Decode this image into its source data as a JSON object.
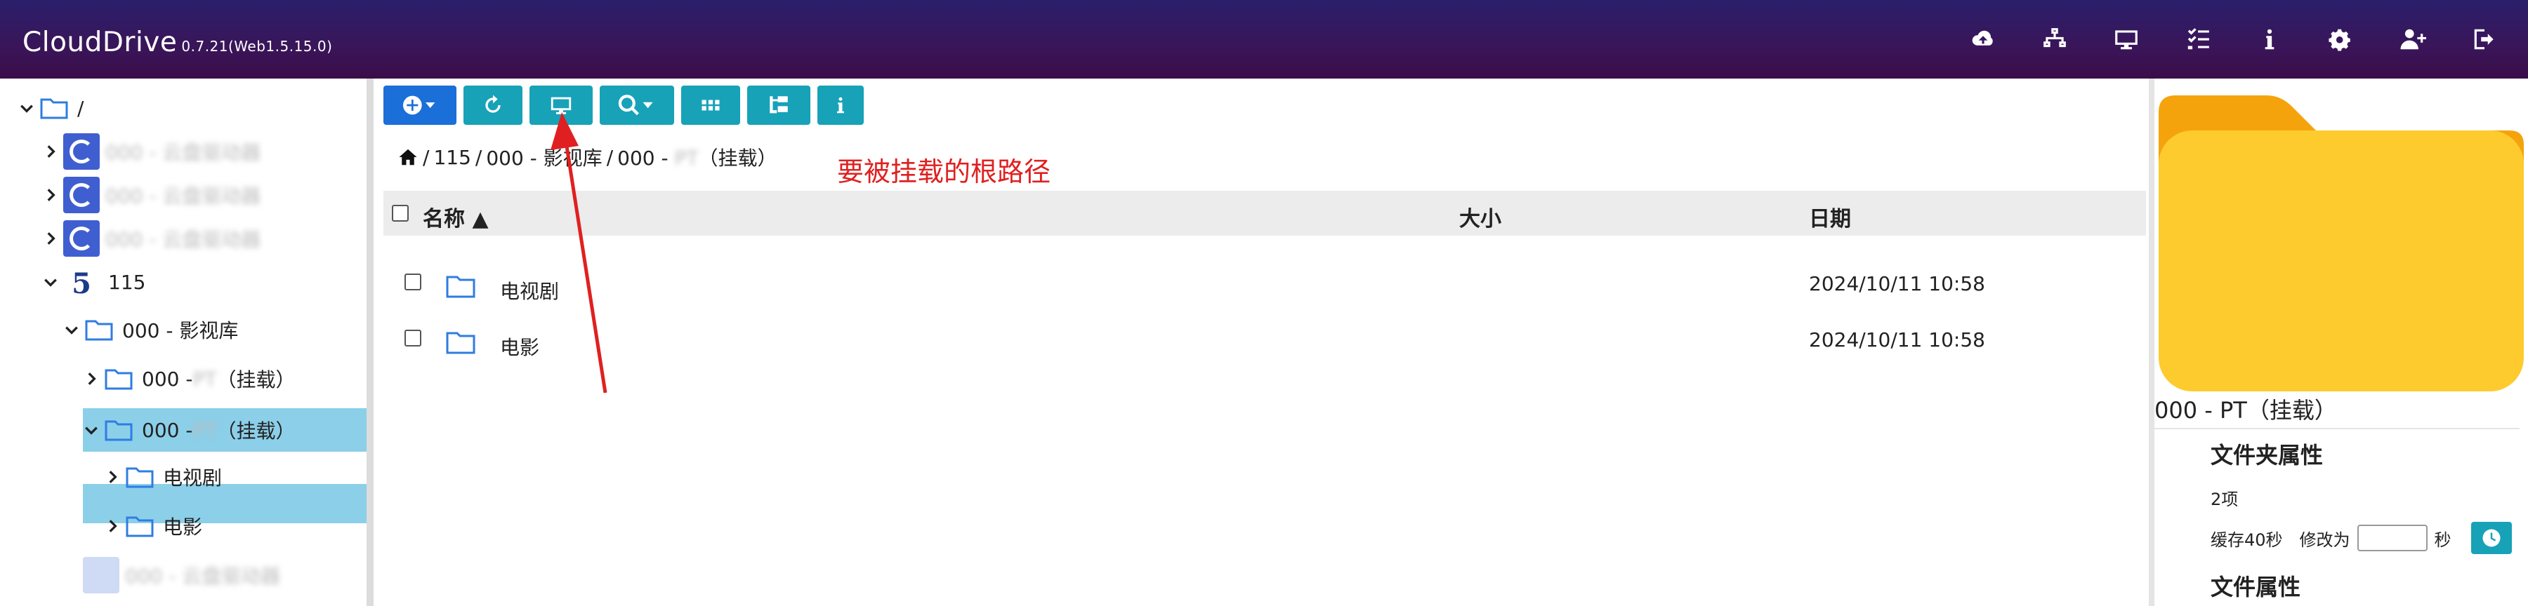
{
  "header": {
    "brand": "CloudDrive",
    "version": "0.7.21(Web1.5.15.0)",
    "icons": [
      "cloud-upload-icon",
      "network-icon",
      "monitor-icon",
      "tasks-icon",
      "info-icon",
      "settings-icon",
      "add-user-icon",
      "logout-icon"
    ],
    "bg_color": "#3a1559"
  },
  "tree": {
    "root": "/",
    "drive_placeholder": "000 - 云盘驱动器",
    "drive115": "115",
    "library": "000 - 影视库",
    "mount1_prefix": "000 - ",
    "mount1_blur": "PT",
    "mount1_suffix": "（挂载）",
    "mount2_prefix": "000 - ",
    "mount2_blur": "PT",
    "mount2_suffix": "（挂载）",
    "child1": "电视剧",
    "child2": "电影",
    "selected_color": "#8ccfe9"
  },
  "breadcrumb": {
    "seg1": "115",
    "seg2": "000 - 影视库",
    "seg3_prefix": "000 - ",
    "seg3_blur": "PT",
    "seg3_suffix": "（挂载）",
    "sep": "/"
  },
  "annotation": "要被挂载的根路径",
  "table": {
    "col_name": "名称",
    "col_size": "大小",
    "col_date": "日期",
    "rows": [
      {
        "name": "电视剧",
        "size": "",
        "date": "2024/10/11 10:58"
      },
      {
        "name": "电影",
        "size": "",
        "date": "2024/10/11 10:58"
      }
    ]
  },
  "panel": {
    "title": "000 - PT（挂载）",
    "folder_props": "文件夹属性",
    "item_count": "2项",
    "cache_label": "缓存40秒",
    "modify_label": "修改为",
    "sec_label": "秒",
    "file_props": "文件属性"
  },
  "colors": {
    "accent": "#17a2b8",
    "primary": "#1b6fd8",
    "folder": "#2f7de1",
    "annotation": "#e02020"
  }
}
